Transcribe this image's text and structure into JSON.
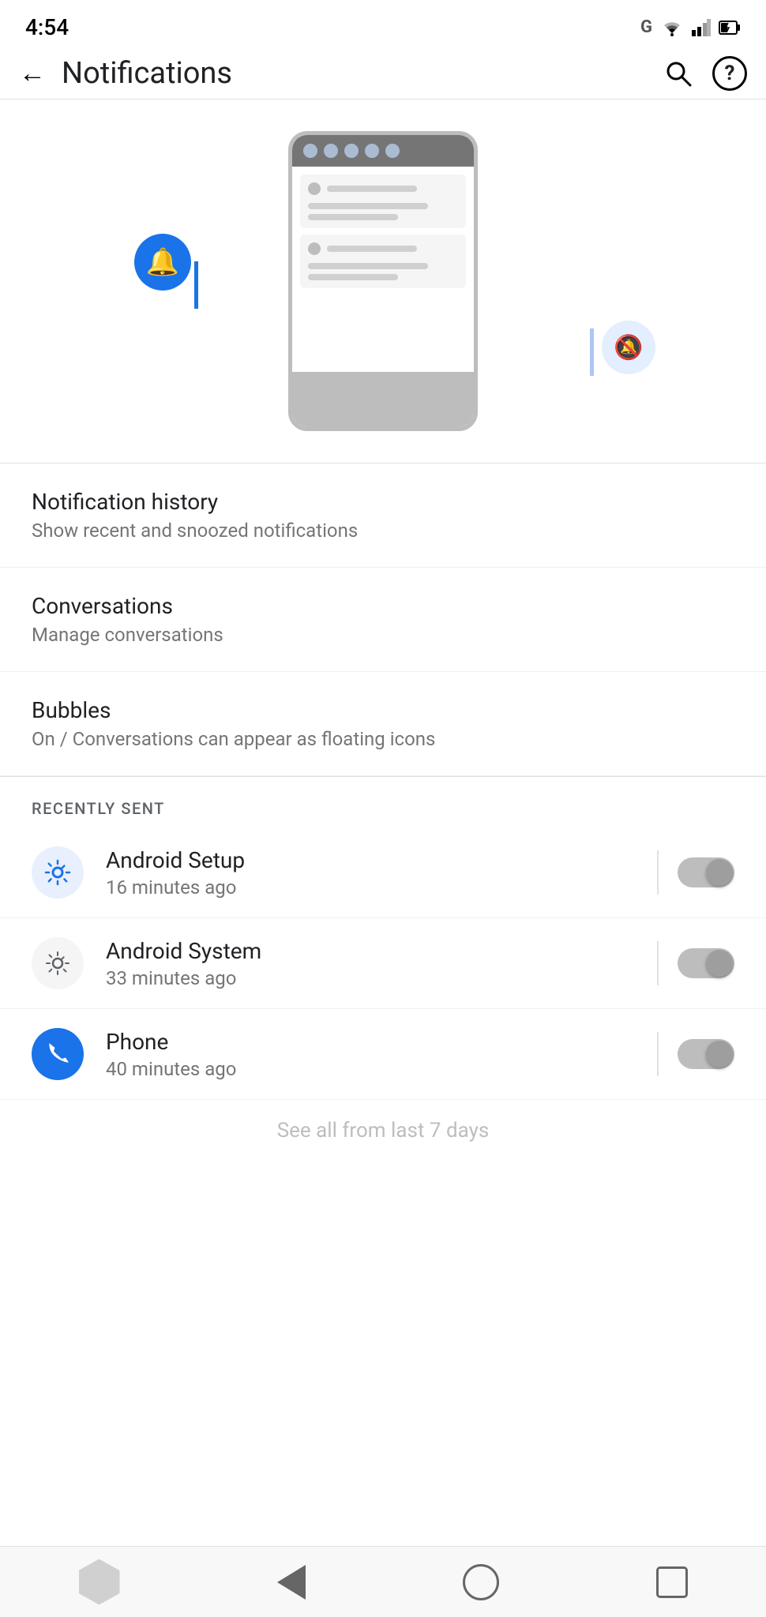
{
  "status_bar": {
    "time": "4:54",
    "wifi_icon": "wifi",
    "signal_icon": "signal",
    "battery_icon": "battery"
  },
  "app_bar": {
    "back_label": "←",
    "title": "Notifications",
    "search_label": "🔍",
    "help_label": "?"
  },
  "illustration": {
    "phone_dots": [
      "dot",
      "dot",
      "dot",
      "dot",
      "dot"
    ],
    "bell_active_icon": "🔔",
    "bell_muted_icon": "🔕"
  },
  "menu_items": [
    {
      "title": "Notification history",
      "subtitle": "Show recent and snoozed notifications"
    },
    {
      "title": "Conversations",
      "subtitle": "Manage conversations"
    },
    {
      "title": "Bubbles",
      "subtitle": "On / Conversations can appear as floating icons"
    }
  ],
  "recently_sent_label": "RECENTLY SENT",
  "recently_sent_apps": [
    {
      "name": "Android Setup",
      "time": "16 minutes ago",
      "icon_color": "#e8f0fe",
      "icon_text_color": "#1a73e8",
      "icon_symbol": "⚙",
      "toggled": false
    },
    {
      "name": "Android System",
      "time": "33 minutes ago",
      "icon_color": "#f5f5f5",
      "icon_text_color": "#5f6368",
      "icon_symbol": "⚙",
      "toggled": false
    },
    {
      "name": "Phone",
      "time": "40 minutes ago",
      "icon_color": "#1a73e8",
      "icon_text_color": "#ffffff",
      "icon_symbol": "📞",
      "toggled": false
    }
  ],
  "see_all_text": "See all from last 7 days",
  "bottom_nav": {
    "recents_label": "recents",
    "home_label": "home",
    "back_label": "back"
  }
}
